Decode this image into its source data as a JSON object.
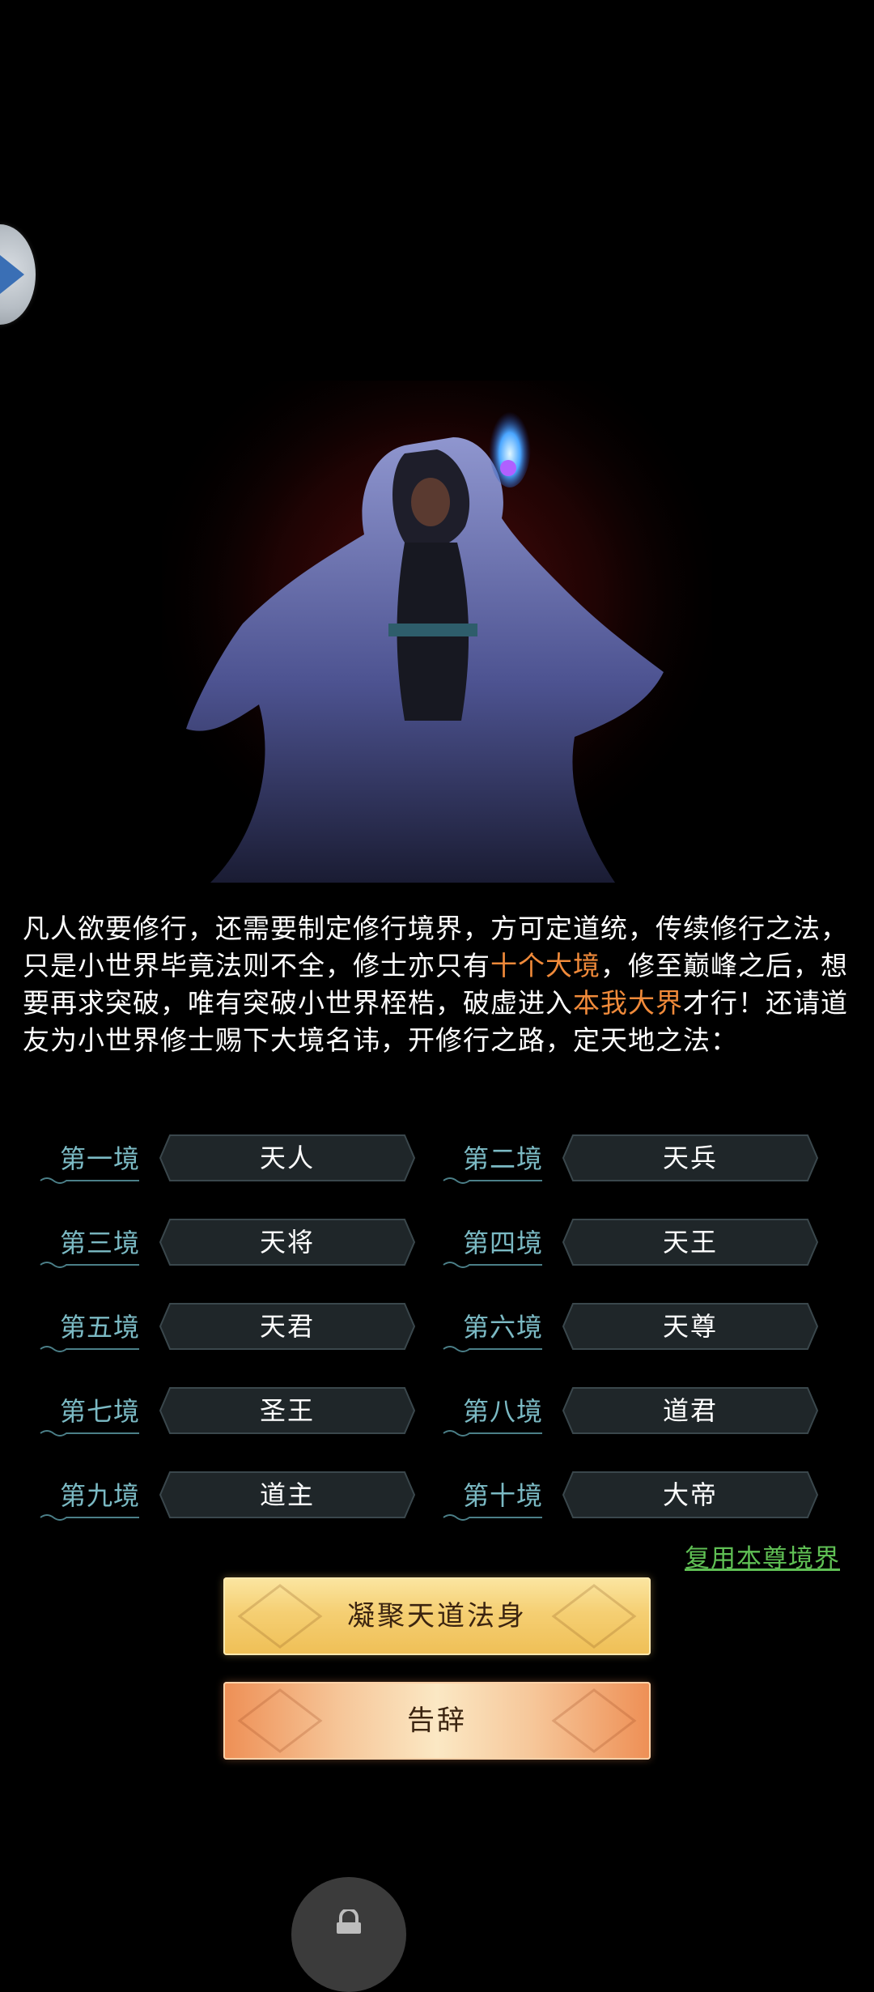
{
  "intro": {
    "seg1": "凡人欲要修行，还需要制定修行境界，方可定道统，传续修行之法，只是小世界毕竟法则不全，修士亦只有",
    "highlight1": "十个大境",
    "seg2": "，修至巅峰之后，想要再求突破，唯有突破小世界桎梏，破虚进入",
    "highlight2": "本我大界",
    "seg3": "才行！还请道友为小世界修士赐下大境名讳，开修行之路，定天地之法："
  },
  "realms": [
    {
      "label": "第一境",
      "value": "天人"
    },
    {
      "label": "第二境",
      "value": "天兵"
    },
    {
      "label": "第三境",
      "value": "天将"
    },
    {
      "label": "第四境",
      "value": "天王"
    },
    {
      "label": "第五境",
      "value": "天君"
    },
    {
      "label": "第六境",
      "value": "天尊"
    },
    {
      "label": "第七境",
      "value": "圣王"
    },
    {
      "label": "第八境",
      "value": "道君"
    },
    {
      "label": "第九境",
      "value": "道主"
    },
    {
      "label": "第十境",
      "value": "大帝"
    }
  ],
  "reuse_link": "复用本尊境界",
  "buttons": {
    "condense": "凝聚天道法身",
    "leave": "告辞"
  },
  "icons": {
    "float": "chevron-right-icon",
    "bottom": "lock-icon"
  },
  "colors": {
    "label": "#7bbac4",
    "highlight": "#f08a3a",
    "link": "#5fbf54"
  }
}
